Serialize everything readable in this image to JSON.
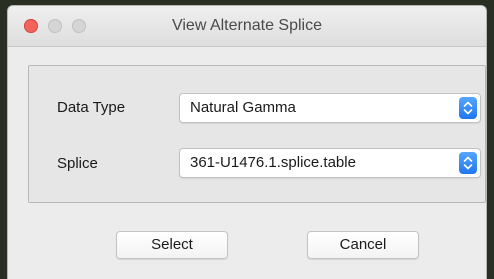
{
  "window": {
    "title": "View Alternate Splice"
  },
  "form": {
    "data_type": {
      "label": "Data Type",
      "selected": "Natural Gamma"
    },
    "splice": {
      "label": "Splice",
      "selected": "361-U1476.1.splice.table"
    }
  },
  "buttons": {
    "select_label": "Select",
    "cancel_label": "Cancel"
  },
  "colors": {
    "close_button": "#f2645b",
    "stepper_accent": "#2a86f5"
  },
  "icons": {
    "popup_indicator": "up-down-chevron-icon"
  }
}
